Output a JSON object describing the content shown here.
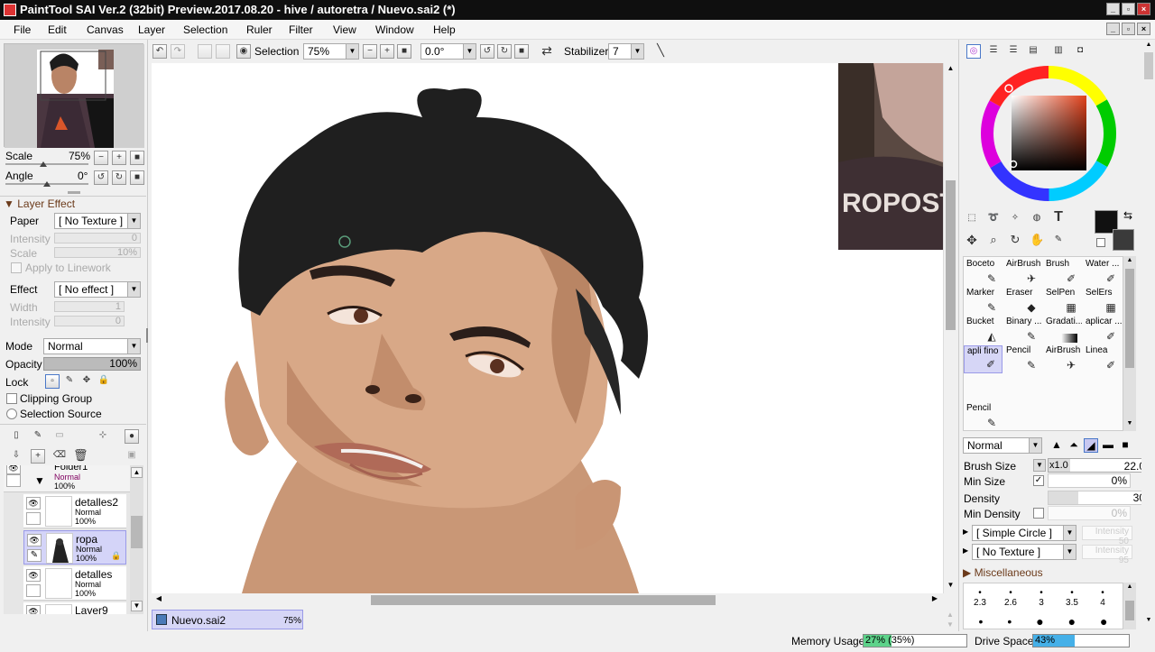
{
  "app": {
    "title": "PaintTool SAI Ver.2 (32bit) Preview.2017.08.20 - hive / autoretra / Nuevo.sai2 (*)"
  },
  "menu": [
    "File",
    "Edit",
    "Canvas",
    "Layer",
    "Selection",
    "Ruler",
    "Filter",
    "View",
    "Window",
    "Help"
  ],
  "toolbar": {
    "selection_label": "Selection",
    "zoom": "75%",
    "angle": "0.0°",
    "stabilizer_label": "Stabilizer",
    "stabilizer_value": "7"
  },
  "navigator": {
    "scale_label": "Scale",
    "scale_value": "75%",
    "angle_label": "Angle",
    "angle_value": "0°"
  },
  "layer_effect": {
    "header": "Layer Effect",
    "paper_label": "Paper",
    "paper_value": "[ No Texture ]",
    "intensity_label": "Intensity",
    "intensity_value": "0",
    "scale_label": "Scale",
    "scale_value": "10%",
    "apply_linework": "Apply to Linework",
    "effect_label": "Effect",
    "effect_value": "[ No effect ]",
    "width_label": "Width",
    "width_value": "1",
    "intensity2_label": "Intensity",
    "intensity2_value": "0"
  },
  "layer_props": {
    "mode_label": "Mode",
    "mode_value": "Normal",
    "opacity_label": "Opacity",
    "opacity_value": "100%",
    "lock_label": "Lock",
    "clipping_group": "Clipping Group",
    "selection_source": "Selection Source"
  },
  "layers": [
    {
      "name": "Folder1",
      "mode": "Normal",
      "opacity": "100%"
    },
    {
      "name": "detalles2",
      "mode": "Normal",
      "opacity": "100%"
    },
    {
      "name": "ropa",
      "mode": "Normal",
      "opacity": "100%"
    },
    {
      "name": "detalles",
      "mode": "Normal",
      "opacity": "100%"
    },
    {
      "name": "Layer9",
      "mode": "",
      "opacity": ""
    }
  ],
  "doc_tab": {
    "name": "Nuevo.sai2",
    "zoom": "75%"
  },
  "tools": [
    {
      "label": "Boceto",
      "icon": "pencil-icon"
    },
    {
      "label": "AirBrush",
      "icon": "airbrush-icon"
    },
    {
      "label": "Brush",
      "icon": "brush-icon"
    },
    {
      "label": "Water ...",
      "icon": "water-icon"
    },
    {
      "label": "Marker",
      "icon": "marker-icon"
    },
    {
      "label": "Eraser",
      "icon": "eraser-icon"
    },
    {
      "label": "SelPen",
      "icon": "selpen-icon"
    },
    {
      "label": "SelErs",
      "icon": "selers-icon"
    },
    {
      "label": "Bucket",
      "icon": "bucket-icon"
    },
    {
      "label": "Binary ...",
      "icon": "binary-icon"
    },
    {
      "label": "Gradati...",
      "icon": "gradient-icon"
    },
    {
      "label": "aplicar ...",
      "icon": "pen-icon"
    },
    {
      "label": "apli fino",
      "icon": "pen-icon"
    },
    {
      "label": "Pencil",
      "icon": "pencil-icon"
    },
    {
      "label": "AirBrush",
      "icon": "airbrush-icon"
    },
    {
      "label": "Linea",
      "icon": "pen-icon"
    },
    {
      "label": "Pencil",
      "icon": "pencil-icon"
    }
  ],
  "brush": {
    "blend_mode": "Normal",
    "size_label": "Brush Size",
    "size_multiplier": "x1.0",
    "size_value": "22.0",
    "min_size_label": "Min Size",
    "min_size_value": "0%",
    "density_label": "Density",
    "density_value": "30",
    "min_density_label": "Min Density",
    "min_density_value": "0%",
    "shape": "[ Simple Circle ]",
    "shape_intensity": "Intensity 50",
    "texture": "[ No Texture ]",
    "texture_intensity": "Intensity 95",
    "misc_label": "Miscellaneous",
    "dot_sizes": [
      "2.3",
      "2.6",
      "3",
      "3.5",
      "4"
    ]
  },
  "status": {
    "memory_label": "Memory Usage",
    "memory_value": "27% (35%)",
    "memory_fill": 0.27,
    "drive_label": "Drive Space",
    "drive_value": "43%",
    "drive_fill": 0.43
  },
  "colors": {
    "title_bg": "#0f0f0f",
    "primary_color": "#111111",
    "secondary_color": "#3a3a3a",
    "memory_bar": "#5dd38a",
    "drive_bar": "#45b0e8"
  }
}
